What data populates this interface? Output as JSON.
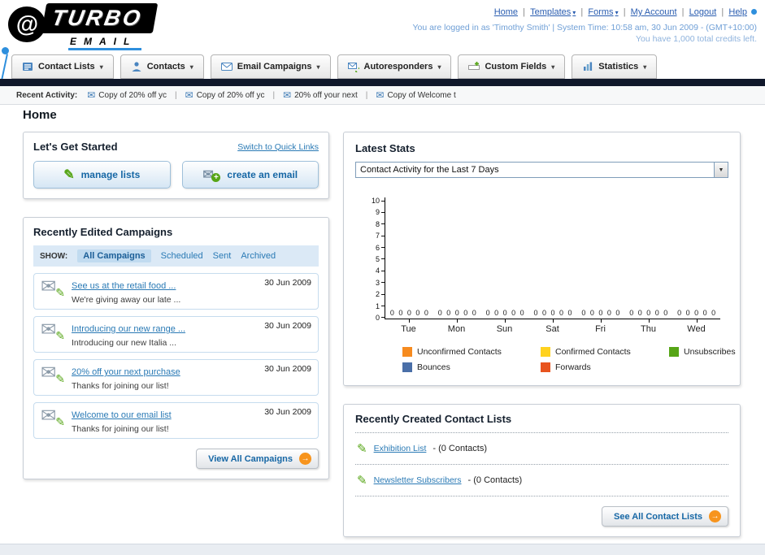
{
  "header": {
    "logo": {
      "title": "TURBO",
      "subtitle": "EMAIL"
    },
    "links": [
      {
        "label": "Home"
      },
      {
        "label": "Templates"
      },
      {
        "label": "Forms"
      },
      {
        "label": "My Account"
      },
      {
        "label": "Logout"
      },
      {
        "label": "Help"
      }
    ],
    "login_line": "You are logged in as 'Timothy Smith' | System Time: 10:58 am, 30 Jun 2009 - (GMT+10:00)",
    "credits_line": "You have 1,000 total credits left."
  },
  "tabs": [
    {
      "label": "Contact Lists"
    },
    {
      "label": "Contacts"
    },
    {
      "label": "Email Campaigns"
    },
    {
      "label": "Autoresponders"
    },
    {
      "label": "Custom Fields"
    },
    {
      "label": "Statistics"
    }
  ],
  "activity": {
    "label": "Recent Activity:",
    "items": [
      "Copy of 20% off yc",
      "Copy of 20% off yc",
      "20% off your next",
      "Copy of Welcome t"
    ]
  },
  "page": {
    "title": "Home"
  },
  "get_started": {
    "title": "Let's Get Started",
    "switch_link": "Switch to Quick Links",
    "manage_label": "manage lists",
    "create_label": "create an email"
  },
  "campaigns": {
    "title": "Recently Edited Campaigns",
    "show_label": "SHOW:",
    "filters": [
      "All Campaigns",
      "Scheduled",
      "Sent",
      "Archived"
    ],
    "active_filter": "All Campaigns",
    "rows": [
      {
        "title": "See us at the retail food ...",
        "subtitle": "We're giving away our late ...",
        "date": "30 Jun 2009"
      },
      {
        "title": "Introducing our new range ...",
        "subtitle": "Introducing our new Italia ...",
        "date": "30 Jun 2009"
      },
      {
        "title": "20% off your next purchase",
        "subtitle": "Thanks for joining our list!",
        "date": "30 Jun 2009"
      },
      {
        "title": "Welcome to our email list",
        "subtitle": "Thanks for joining our list!",
        "date": "30 Jun 2009"
      }
    ],
    "view_all": "View All Campaigns"
  },
  "stats": {
    "title": "Latest Stats",
    "period": "Contact Activity for the Last 7 Days",
    "chart_data": {
      "type": "bar",
      "categories": [
        "Tue",
        "Mon",
        "Sun",
        "Sat",
        "Fri",
        "Thu",
        "Wed"
      ],
      "series": [
        {
          "name": "Unconfirmed Contacts",
          "color": "#f68b1f",
          "values": [
            0,
            0,
            0,
            0,
            0,
            0,
            0
          ]
        },
        {
          "name": "Confirmed Contacts",
          "color": "#ffd21f",
          "values": [
            0,
            0,
            0,
            0,
            0,
            0,
            0
          ]
        },
        {
          "name": "Unsubscribes",
          "color": "#56a516",
          "values": [
            0,
            0,
            0,
            0,
            0,
            0,
            0
          ]
        },
        {
          "name": "Bounces",
          "color": "#4a6fa8",
          "values": [
            0,
            0,
            0,
            0,
            0,
            0,
            0
          ]
        },
        {
          "name": "Forwards",
          "color": "#e8541f",
          "values": [
            0,
            0,
            0,
            0,
            0,
            0,
            0
          ]
        }
      ],
      "ylim": [
        0,
        10
      ],
      "yticks": [
        0,
        1,
        2,
        3,
        4,
        5,
        6,
        7,
        8,
        9,
        10
      ],
      "legend_position": "bottom",
      "grid": false
    }
  },
  "lists": {
    "title": "Recently Created Contact Lists",
    "items": [
      {
        "name": "Exhibition List",
        "suffix": "- (0 Contacts)"
      },
      {
        "name": "Newsletter Subscribers",
        "suffix": "- (0 Contacts)"
      }
    ],
    "see_all": "See All Contact Lists"
  },
  "colors": {
    "brand_blue": "#1667a5",
    "dark_bar": "#10182b",
    "accent_orange": "#f7941d",
    "link_blue": "#2a7ab5"
  }
}
